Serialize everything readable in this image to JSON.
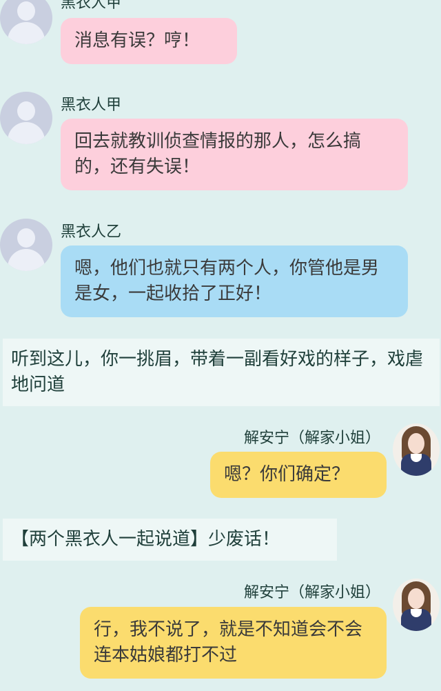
{
  "messages": [
    {
      "speaker": "黑衣人甲",
      "text": "消息有误？哼！"
    },
    {
      "speaker": "黑衣人甲",
      "text": "回去就教训侦查情报的那人，怎么搞的，还有失误！"
    },
    {
      "speaker": "黑衣人乙",
      "text": "嗯，他们也就只有两个人，你管他是男是女，一起收拾了正好！"
    },
    {
      "narration": "听到这儿，你一挑眉，带着一副看好戏的样子，戏虐地问道"
    },
    {
      "speaker": "解安宁（解家小姐）",
      "text": "嗯？你们确定？"
    },
    {
      "narration": "【两个黑衣人一起说道】少废话！"
    },
    {
      "speaker": "解安宁（解家小姐）",
      "text": "行，我不说了，就是不知道会不会连本姑娘都打不过"
    }
  ],
  "colors": {
    "background": "#dff0ef",
    "pink_bubble": "#fdcfdc",
    "blue_bubble": "#a9dcf5",
    "yellow_bubble": "#fbdc6e",
    "narration_bg": "#eef7f6"
  }
}
